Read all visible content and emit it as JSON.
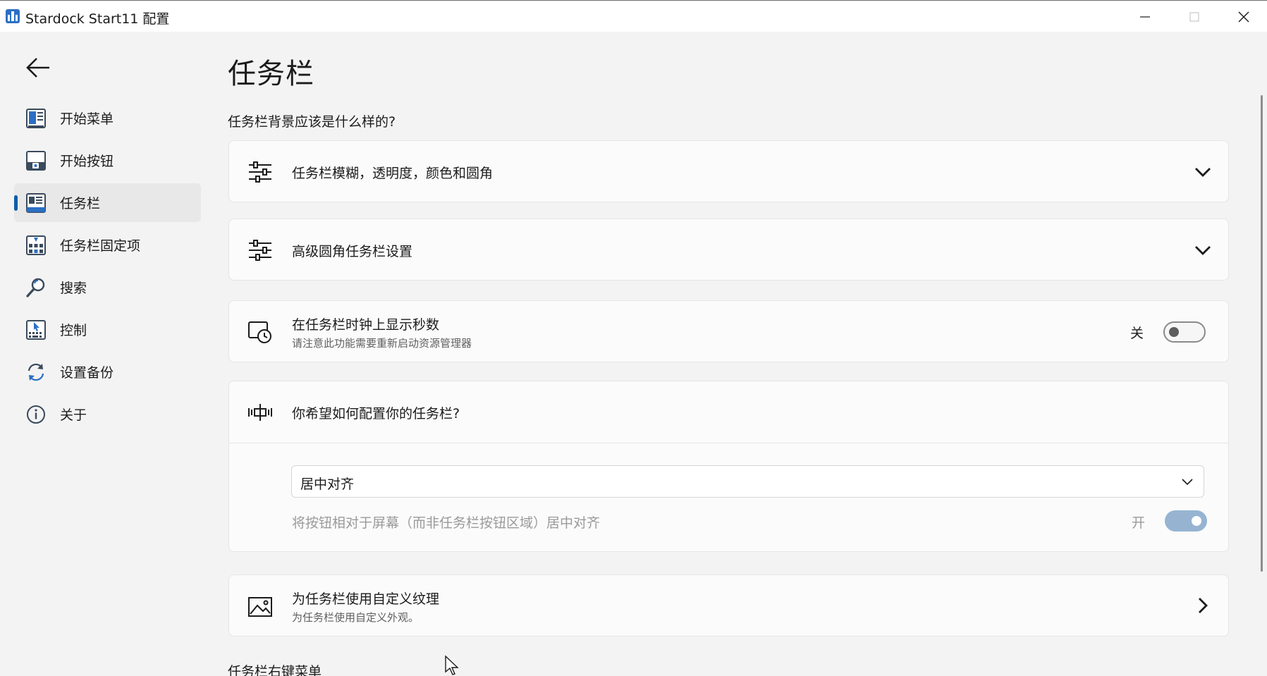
{
  "window": {
    "title": "Stardock Start11 配置",
    "controls": [
      "minimize",
      "maximize",
      "close"
    ]
  },
  "sidebar": {
    "back_icon": "arrow-left-icon",
    "items": [
      {
        "label": "开始菜单",
        "icon": "start-menu-icon",
        "active": false
      },
      {
        "label": "开始按钮",
        "icon": "start-button-icon",
        "active": false
      },
      {
        "label": "任务栏",
        "icon": "taskbar-icon",
        "active": true
      },
      {
        "label": "任务栏固定项",
        "icon": "taskbar-pins-icon",
        "active": false
      },
      {
        "label": "搜索",
        "icon": "search-icon",
        "active": false
      },
      {
        "label": "控制",
        "icon": "control-icon",
        "active": false
      },
      {
        "label": "设置备份",
        "icon": "backup-icon",
        "active": false
      },
      {
        "label": "关于",
        "icon": "info-icon",
        "active": false
      }
    ],
    "accent": "#0c5ca8"
  },
  "main": {
    "title": "任务栏",
    "section_label": "任务栏背景应该是什么样的?",
    "cards": {
      "blur": {
        "title": "任务栏模糊，透明度，颜色和圆角",
        "icon": "sliders-icon"
      },
      "advanced": {
        "title": "高级圆角任务栏设置",
        "icon": "sliders-icon"
      },
      "clock": {
        "title": "在任务栏时钟上显示秒数",
        "subtitle": "请注意此功能需要重新启动资源管理器",
        "toggle_label": "关",
        "toggle_on": false,
        "icon": "clock-monitor-icon"
      },
      "alignment": {
        "title": "你希望如何配置你的任务栏?",
        "icon": "align-center-icon",
        "select_value": "居中对齐",
        "option_text": "将按钮相对于屏幕（而非任务栏按钮区域）居中对齐",
        "option_toggle_label": "开",
        "option_toggle_on": true
      },
      "texture": {
        "title": "为任务栏使用自定义纹理",
        "subtitle": "为任务栏使用自定义外观。",
        "icon": "image-icon"
      }
    },
    "bottom_label": "任务栏右键菜单"
  }
}
